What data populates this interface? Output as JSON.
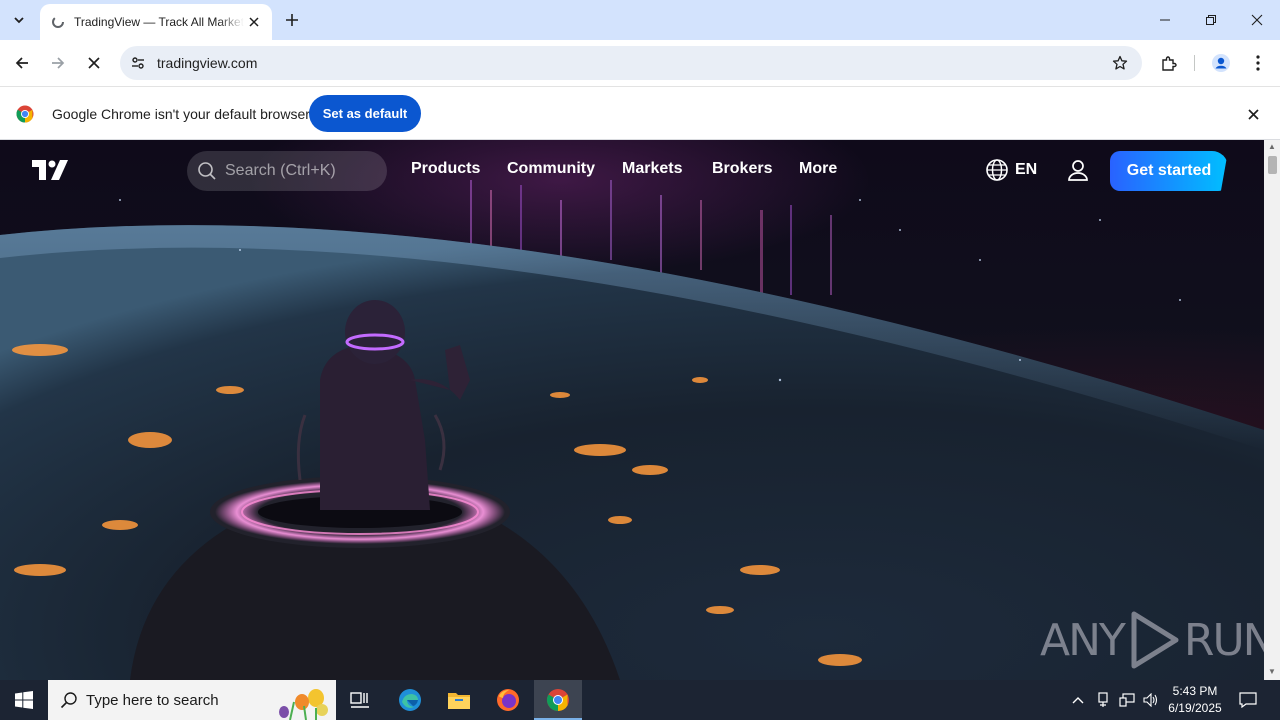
{
  "browser": {
    "tab_title": "TradingView — Track All Markets",
    "url": "tradingview.com",
    "infobar_text": "Google Chrome isn't your default browser",
    "infobar_button": "Set as default"
  },
  "site": {
    "search_placeholder": "Search (Ctrl+K)",
    "nav": [
      "Products",
      "Community",
      "Markets",
      "Brokers",
      "More"
    ],
    "language": "EN",
    "cta": "Get started"
  },
  "watermark": {
    "left": "ANY",
    "right": "RUN"
  },
  "taskbar": {
    "search_placeholder": "Type here to search",
    "time": "5:43 PM",
    "date": "6/19/2025"
  },
  "colors": {
    "tabstrip": "#d3e3fd",
    "chrome_blue": "#0b57d0",
    "cta_start": "#2962ff",
    "cta_end": "#00bfff",
    "taskbar": "#1c2433"
  },
  "icons": [
    "tab-search-icon",
    "loading-favicon-icon",
    "close-icon",
    "plus-icon",
    "minimize-icon",
    "restore-icon",
    "back-icon",
    "forward-icon",
    "stop-icon",
    "site-info-icon",
    "star-icon",
    "extensions-icon",
    "profile-icon",
    "kebab-menu-icon",
    "chrome-logo-icon",
    "tradingview-logo",
    "search-icon",
    "globe-icon",
    "user-icon",
    "windows-start-icon",
    "task-view-icon",
    "edge-icon",
    "file-explorer-icon",
    "firefox-icon",
    "chrome-icon",
    "tray-chevron-icon",
    "network-icon",
    "volume-icon",
    "notification-icon"
  ]
}
